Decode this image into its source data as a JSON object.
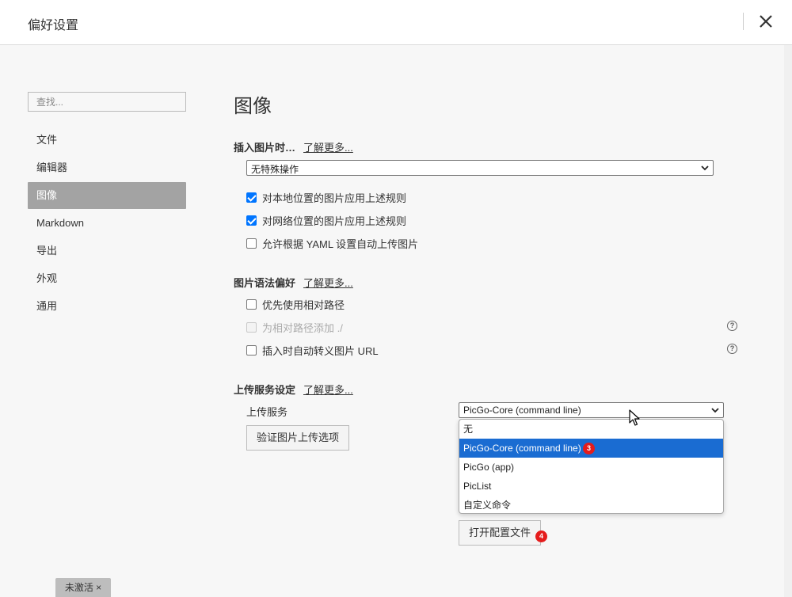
{
  "window": {
    "title": "偏好设置",
    "close_icon": "close-icon"
  },
  "sidebar": {
    "search_placeholder": "查找...",
    "items": [
      {
        "label": "文件"
      },
      {
        "label": "编辑器"
      },
      {
        "label": "图像",
        "active": true
      },
      {
        "label": "Markdown"
      },
      {
        "label": "导出"
      },
      {
        "label": "外观"
      },
      {
        "label": "通用"
      }
    ]
  },
  "main": {
    "title": "图像",
    "insert": {
      "heading": "插入图片时…",
      "more": "了解更多...",
      "select_value": "无特殊操作",
      "checks": [
        {
          "label": "对本地位置的图片应用上述规则",
          "checked": true
        },
        {
          "label": "对网络位置的图片应用上述规则",
          "checked": true
        },
        {
          "label": "允许根据 YAML 设置自动上传图片",
          "checked": false
        }
      ]
    },
    "syntax": {
      "heading": "图片语法偏好",
      "more": "了解更多...",
      "checks": [
        {
          "label": "优先使用相对路径",
          "checked": false
        },
        {
          "label": "为相对路径添加 ./",
          "checked": false,
          "disabled": true
        },
        {
          "label": "插入时自动转义图片 URL",
          "checked": false
        }
      ],
      "help_icon": "?"
    },
    "upload": {
      "heading": "上传服务设定",
      "more": "了解更多...",
      "service_label": "上传服务",
      "service_value": "PicGo-Core (command line)",
      "verify_button": "验证图片上传选项",
      "open_config_button": "打开配置文件",
      "options": [
        {
          "label": "无"
        },
        {
          "label": "PicGo-Core (command line)",
          "selected": true
        },
        {
          "label": "PicGo (app)"
        },
        {
          "label": "PicList"
        },
        {
          "label": "自定义命令"
        }
      ],
      "badge_dropdown": "3",
      "badge_config": "4"
    }
  },
  "footer": {
    "tag": "未激活 ×"
  },
  "colors": {
    "accent": "#1a6cd2",
    "checkbox": "#0075ff",
    "badge": "#e51c1c",
    "nav_active": "#a3a3a3"
  }
}
